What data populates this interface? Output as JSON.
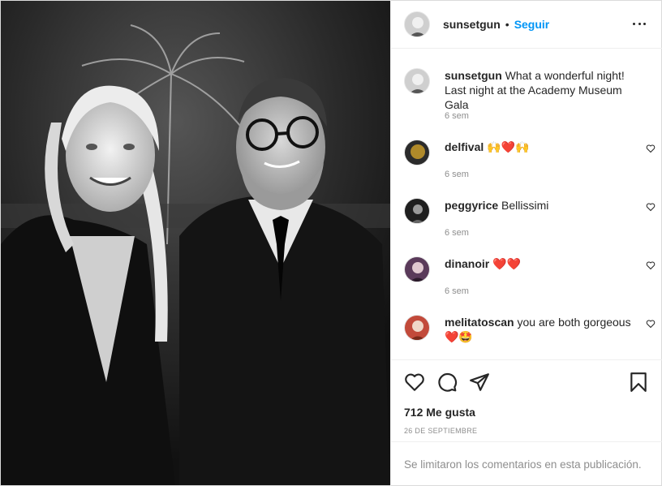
{
  "post": {
    "author": "sunsetgun",
    "separator": "•",
    "follow_label": "Seguir",
    "more_icon": "more-options-icon"
  },
  "caption": {
    "username": "sunsetgun",
    "text": "What a wonderful night! Last night at the Academy Museum Gala",
    "time": "6 sem"
  },
  "comments": [
    {
      "username": "delfival",
      "text": "🙌❤️🙌",
      "time": "6 sem"
    },
    {
      "username": "peggyrice",
      "text": "Bellissimi",
      "time": "6 sem"
    },
    {
      "username": "dinanoir",
      "text": "❤️❤️",
      "time": "6 sem"
    },
    {
      "username": "melitatoscan",
      "text": "you are both gorgeous ❤️🤩",
      "time": ""
    }
  ],
  "actions": {
    "likes": "712 Me gusta",
    "date": "26 de septiembre",
    "comments_limited": "Se limitaron los comentarios en esta publicación."
  },
  "colors": {
    "accent": "#0095f6",
    "text": "#262626",
    "muted": "#8e8e8e",
    "divider": "#efefef"
  },
  "icons": [
    "heart-icon",
    "comment-icon",
    "share-icon",
    "bookmark-icon",
    "like-comment-icon"
  ]
}
